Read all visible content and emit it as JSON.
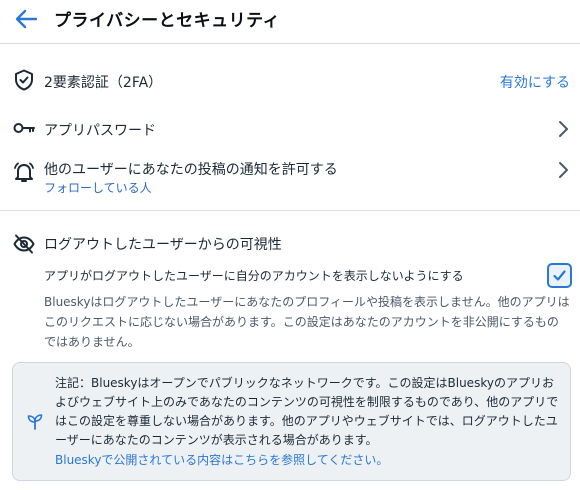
{
  "header": {
    "title": "プライバシーとセキュリティ",
    "back_icon": "arrow-left-icon"
  },
  "two_factor": {
    "label": "2要素認証（2FA）",
    "action": "有効にする",
    "icon": "shield-check-icon"
  },
  "app_passwords": {
    "label": "アプリパスワード",
    "icon": "key-icon"
  },
  "notifications": {
    "label": "他のユーザーにあなたの投稿の通知を許可する",
    "sublabel": "フォローしている人",
    "icon": "bell-icon"
  },
  "visibility": {
    "title": "ログアウトしたユーザーからの可視性",
    "icon": "eye-slash-icon",
    "toggle_label": "アプリがログアウトしたユーザーに自分のアカウントを表示しないようにする",
    "checked": true,
    "description": "Blueskyはログアウトしたユーザーにあなたのプロフィールや投稿を表示しません。他のアプリはこのリクエストに応じない場合があります。この設定はあなたのアカウントを非公開にするものではありません。"
  },
  "note": {
    "icon": "sprout-icon",
    "text": "注記：Blueskyはオープンでパブリックなネットワークです。この設定はBlueskyのアプリおよびウェブサイト上のみであなたのコンテンツの可視性を制限するものであり、他のアプリではこの設定を尊重しない場合があります。他のアプリやウェブサイトでは、ログアウトしたユーザーにあなたのコンテンツが表示される場合があります。",
    "link": "Blueskyで公開されている内容はこちらを参照してください。"
  },
  "colors": {
    "accent": "#2a78d4",
    "text": "#1c2a36",
    "muted": "#4b5968",
    "note_bg": "#eef1f4"
  }
}
